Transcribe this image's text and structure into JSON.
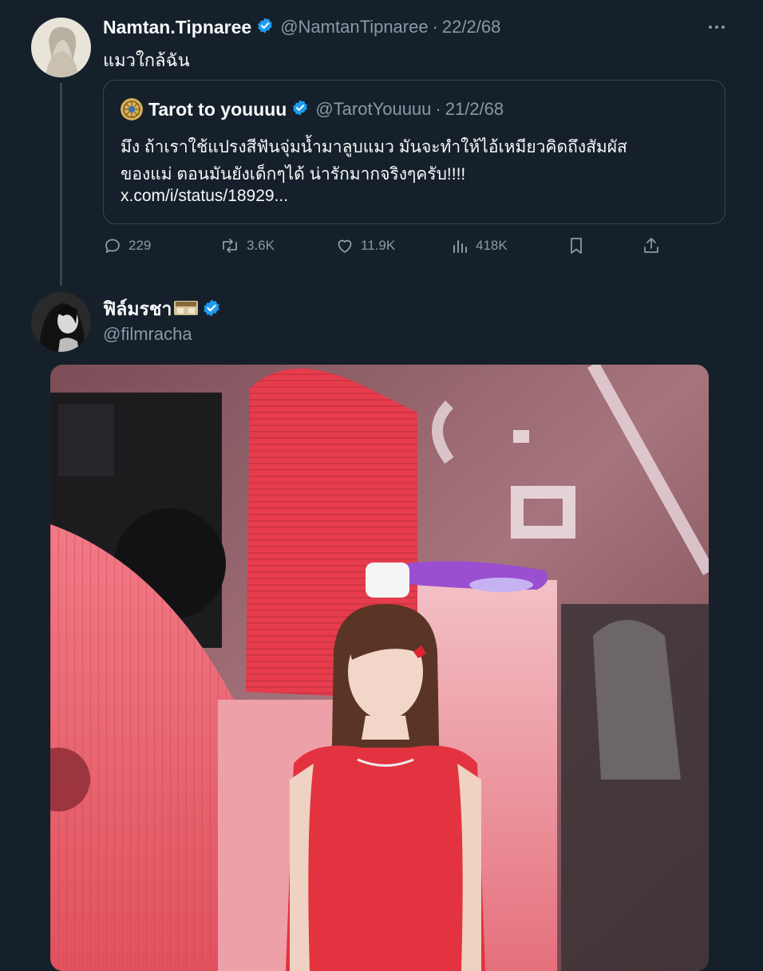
{
  "tweet1": {
    "display_name": "Namtan.Tipnaree",
    "handle": "@NamtanTipnaree",
    "date": "22/2/68",
    "text": "แมวใกล้ฉัน",
    "quote": {
      "display_name": "Tarot to youuuu",
      "handle": "@TarotYouuuu",
      "date": "21/2/68",
      "line1": "มึง ถ้าเราใช้แปรงสีฟันจุ่มน้ำมาลูบแมว มันจะทำให้ไอ้เหมียวคิดถึงสัมผัส",
      "line2": "ของแม่ ตอนมันยังเด็กๆได้ น่ารักมากจริงๆครับ!!!!",
      "link": "x.com/i/status/18929..."
    },
    "actions": {
      "replies": "229",
      "retweets": "3.6K",
      "likes": "11.9K",
      "views": "418K"
    }
  },
  "tweet2": {
    "display_name": "ฟิล์มรชา",
    "handle": "@filmracha"
  },
  "colors": {
    "background": "#15202b",
    "verified": "#1d9bf0",
    "muted": "#8b98a5",
    "border": "#38444d"
  }
}
